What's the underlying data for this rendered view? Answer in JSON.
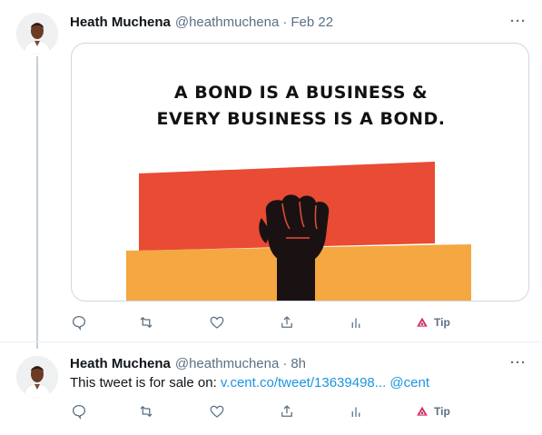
{
  "tweets": [
    {
      "author_name": "Heath Muchena",
      "handle": "@heathmuchena",
      "separator": "·",
      "time": "Feb 22",
      "more": "···",
      "media": {
        "title_line1": "A BOND IS A BUSINESS &",
        "title_line2": "EVERY BUSINESS IS A BOND.",
        "colors": {
          "red": "#e94b35",
          "orange": "#f5a742",
          "fist": "#1a1212"
        }
      },
      "actions": {
        "tip_label": "Tip"
      }
    },
    {
      "author_name": "Heath Muchena",
      "handle": "@heathmuchena",
      "separator": "·",
      "time": "8h",
      "more": "···",
      "text_prefix": "This tweet is for sale on: ",
      "link_text": "v.cent.co/tweet/13639498...",
      "mention": "@cent",
      "actions": {
        "tip_label": "Tip"
      }
    }
  ],
  "colors": {
    "link": "#1b95e0",
    "secondary": "#5b7083",
    "tip_accent": "#e0245e"
  }
}
